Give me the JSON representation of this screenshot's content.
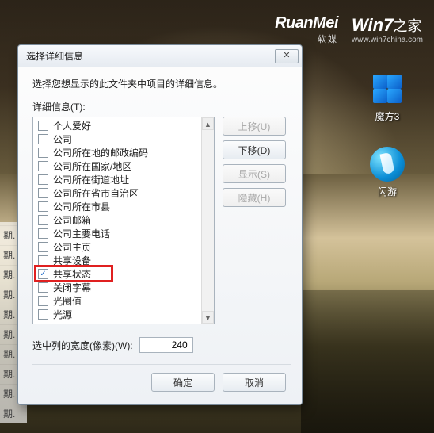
{
  "brand": {
    "ruanmei": "RuanMei",
    "ruanmei_sub": "软媒",
    "win7_title": "Win7",
    "win7_suffix": "之家",
    "win7_url": "www.win7china.com"
  },
  "desktop": {
    "cube_label": "魔方3",
    "leaf_label": "闪游"
  },
  "leftcol_text": "期.",
  "dialog": {
    "title": "选择详细信息",
    "intro": "选择您想显示的此文件夹中项目的详细信息。",
    "list_label": "详细信息(T):",
    "items": [
      {
        "label": "个人爱好",
        "checked": false
      },
      {
        "label": "公司",
        "checked": false
      },
      {
        "label": "公司所在地的邮政编码",
        "checked": false
      },
      {
        "label": "公司所在国家/地区",
        "checked": false
      },
      {
        "label": "公司所在街道地址",
        "checked": false
      },
      {
        "label": "公司所在省市自治区",
        "checked": false
      },
      {
        "label": "公司所在市县",
        "checked": false
      },
      {
        "label": "公司邮箱",
        "checked": false
      },
      {
        "label": "公司主要电话",
        "checked": false
      },
      {
        "label": "公司主页",
        "checked": false
      },
      {
        "label": "共享设备",
        "checked": false
      },
      {
        "label": "共享状态",
        "checked": true
      },
      {
        "label": "关闭字幕",
        "checked": false
      },
      {
        "label": "光圈值",
        "checked": false
      },
      {
        "label": "光源",
        "checked": false
      }
    ],
    "highlight_index": 11,
    "buttons": {
      "move_up": "上移(U)",
      "move_down": "下移(D)",
      "show": "显示(S)",
      "hide": "隐藏(H)"
    },
    "width_label": "选中列的宽度(像素)(W):",
    "width_value": "240",
    "ok": "确定",
    "cancel": "取消"
  }
}
